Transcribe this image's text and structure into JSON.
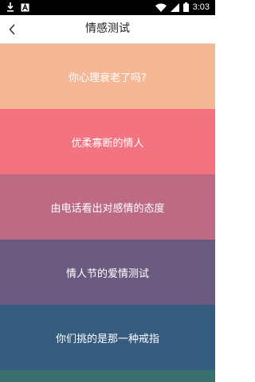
{
  "status_bar": {
    "time": "3:03",
    "left_icons": [
      "download-icon",
      "text-a-icon"
    ],
    "right_icons": [
      "wifi-icon",
      "signal-icon",
      "battery-icon"
    ]
  },
  "header": {
    "title": "情感测试",
    "back_icon": "chevron-left-icon"
  },
  "tests": [
    {
      "label": "你心理衰老了吗?",
      "color": "#F5B896"
    },
    {
      "label": "优柔寡断的情人",
      "color": "#F47380"
    },
    {
      "label": "由电话看出对感情的态度",
      "color": "#BF6A84"
    },
    {
      "label": "情人节的爱情测试",
      "color": "#6B5A80"
    },
    {
      "label": "你们挑的是那一种戒指",
      "color": "#355B7E"
    },
    {
      "label": "",
      "color": "#39706E"
    }
  ]
}
